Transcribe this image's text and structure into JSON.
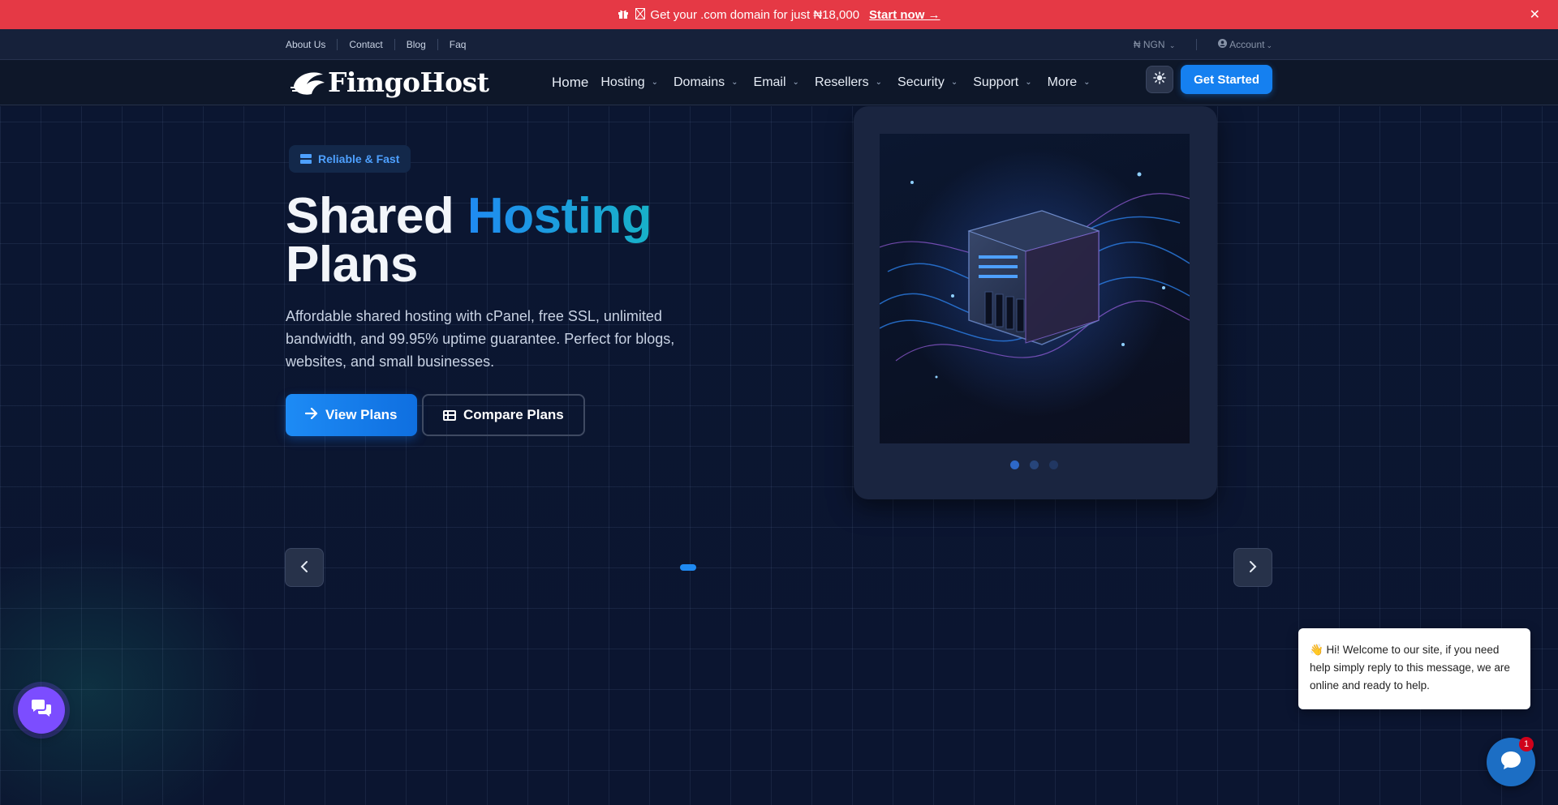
{
  "promo": {
    "gift_icon": "gift-icon",
    "text": "Get your .com domain for just ₦18,000",
    "cta": "Start now →",
    "close": "✕"
  },
  "utility": {
    "links": [
      "About Us",
      "Contact",
      "Blog",
      "Faq"
    ],
    "currency": "₦ NGN",
    "account": "Account"
  },
  "nav": {
    "logo": "FimgoHost",
    "items": [
      {
        "label": "Home"
      },
      {
        "label": "Hosting"
      },
      {
        "label": "Domains"
      },
      {
        "label": "Email"
      },
      {
        "label": "Resellers"
      },
      {
        "label": "Security"
      },
      {
        "label": "Support"
      },
      {
        "label": "More"
      }
    ],
    "cta": "Get Started",
    "theme_icon": "sun-icon"
  },
  "hero": {
    "badge": "Reliable & Fast",
    "title_part1": "Shared ",
    "title_accent": "Hosting",
    "title_part2": "Plans",
    "description": "Affordable shared hosting with cPanel, free SSL, unlimited bandwidth, and 99.95% uptime guarantee. Perfect for blogs, websites, and small businesses.",
    "primary_button": "View Plans",
    "secondary_button": "Compare Plans",
    "image_dots": 3,
    "active_dot": 1
  },
  "chat": {
    "welcome_message": "👋 Hi! Welcome to our site, if you need help simply reply to this message, we are online and ready to help.",
    "unread_count": "1"
  },
  "colors": {
    "promo": "#e53945",
    "accent": "#1580f0",
    "background": "#0b1428",
    "chat_purple": "#7c4dff"
  }
}
